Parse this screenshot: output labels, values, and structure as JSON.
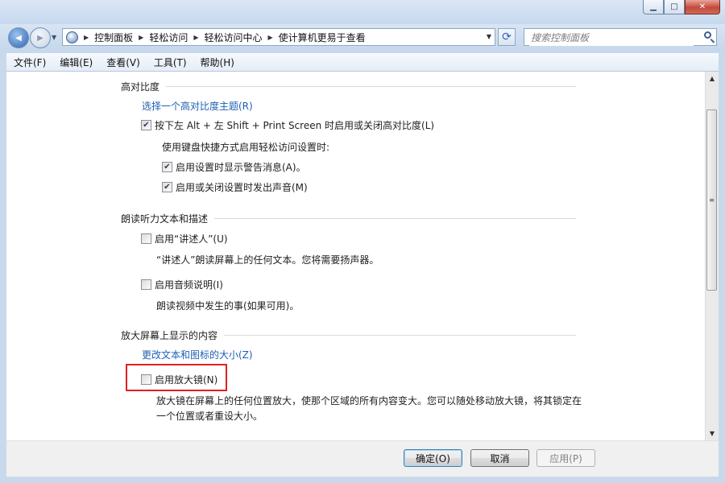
{
  "window": {
    "minimize_glyph": "▁",
    "maximize_glyph": "□",
    "close_glyph": "✕"
  },
  "nav": {
    "back_glyph": "◀",
    "forward_glyph": "▶",
    "history_drop_glyph": "▼",
    "breadcrumb": [
      "控制面板",
      "轻松访问",
      "轻松访问中心",
      "使计算机更易于查看"
    ],
    "separator_glyph": "▶",
    "address_drop_glyph": "▼",
    "refresh_glyph": "⟳",
    "search_placeholder": "搜索控制面板"
  },
  "menu": [
    "文件(F)",
    "编辑(E)",
    "查看(V)",
    "工具(T)",
    "帮助(H)"
  ],
  "sections": {
    "high_contrast": {
      "title": "高对比度",
      "theme_link": "选择一个高对比度主题(R)",
      "toggle_checkbox": {
        "label": "按下左 Alt + 左 Shift + Print Screen 时启用或关闭高对比度(L)",
        "checked": true
      },
      "shortcut_heading": "使用键盘快捷方式启用轻松访问设置时:",
      "warning_checkbox": {
        "label": "启用设置时显示警告消息(A)。",
        "checked": true
      },
      "sound_checkbox": {
        "label": "启用或关闭设置时发出声音(M)",
        "checked": true
      }
    },
    "narration": {
      "title": "朗读听力文本和描述",
      "narrator_checkbox": {
        "label": "启用“讲述人”(U)",
        "checked": false
      },
      "narrator_desc": "“讲述人”朗读屏幕上的任何文本。您将需要扬声器。",
      "audio_desc_checkbox": {
        "label": "启用音频说明(I)",
        "checked": false
      },
      "audio_desc_desc": "朗读视频中发生的事(如果可用)。"
    },
    "magnify": {
      "title": "放大屏幕上显示的内容",
      "size_link": "更改文本和图标的大小(Z)",
      "magnifier_checkbox": {
        "label": "启用放大镜(N)",
        "checked": false
      },
      "magnifier_desc_1": "放大镜在屏幕上的任何位置放大，使那个区域的所有内容变大。您可以随处移动放大镜，将其锁定在",
      "magnifier_desc_2": "一个位置或者重设大小。"
    }
  },
  "scrollbar": {
    "up_glyph": "▲",
    "down_glyph": "▼",
    "grip_glyph": "≡"
  },
  "buttons": {
    "ok": "确定(O)",
    "cancel": "取消",
    "apply": "应用(P)"
  },
  "colors": {
    "link": "#1e5fb4",
    "highlight_box": "#e02020"
  }
}
